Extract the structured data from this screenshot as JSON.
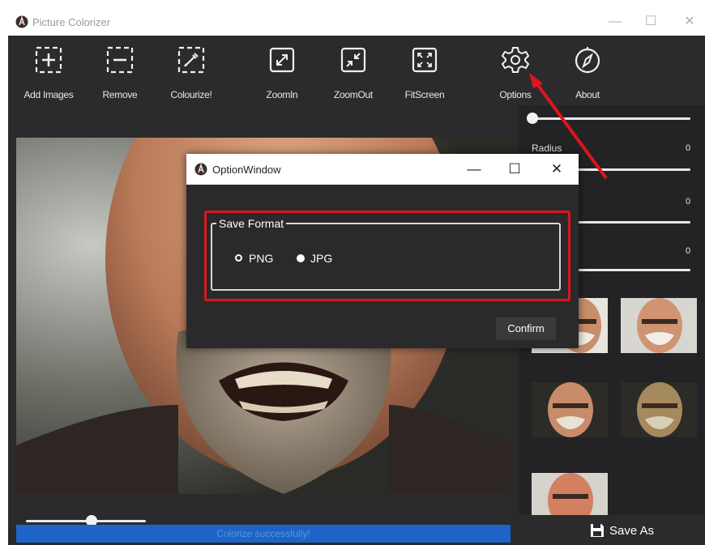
{
  "app": {
    "title": "Picture Colorizer"
  },
  "toolbar": {
    "items": [
      {
        "label": "Add Images",
        "icon": "add-images-icon"
      },
      {
        "label": "Remove",
        "icon": "remove-icon"
      },
      {
        "label": "Colourize!",
        "icon": "colourize-icon"
      },
      {
        "label": "ZoomIn",
        "icon": "zoom-in-icon"
      },
      {
        "label": "ZoomOut",
        "icon": "zoom-out-icon"
      },
      {
        "label": "FitScreen",
        "icon": "fit-screen-icon"
      },
      {
        "label": "Options",
        "icon": "gear-icon"
      },
      {
        "label": "About",
        "icon": "compass-icon"
      }
    ]
  },
  "right_panel": {
    "radius_label": "Radius",
    "radius_value": "0",
    "value2": "0",
    "value3": "0",
    "save_as_label": "Save As"
  },
  "status": {
    "text": "Colorize successfully!"
  },
  "zoom_slider": {
    "level": 0.55
  },
  "dialog": {
    "title": "OptionWindow",
    "group_label": "Save Format",
    "options": [
      {
        "label": "PNG",
        "selected": false
      },
      {
        "label": "JPG",
        "selected": true
      }
    ],
    "confirm_label": "Confirm"
  },
  "colors": {
    "accent_blue": "#1e64c8",
    "highlight_red": "#d8161d",
    "background": "#2a2a2c"
  }
}
